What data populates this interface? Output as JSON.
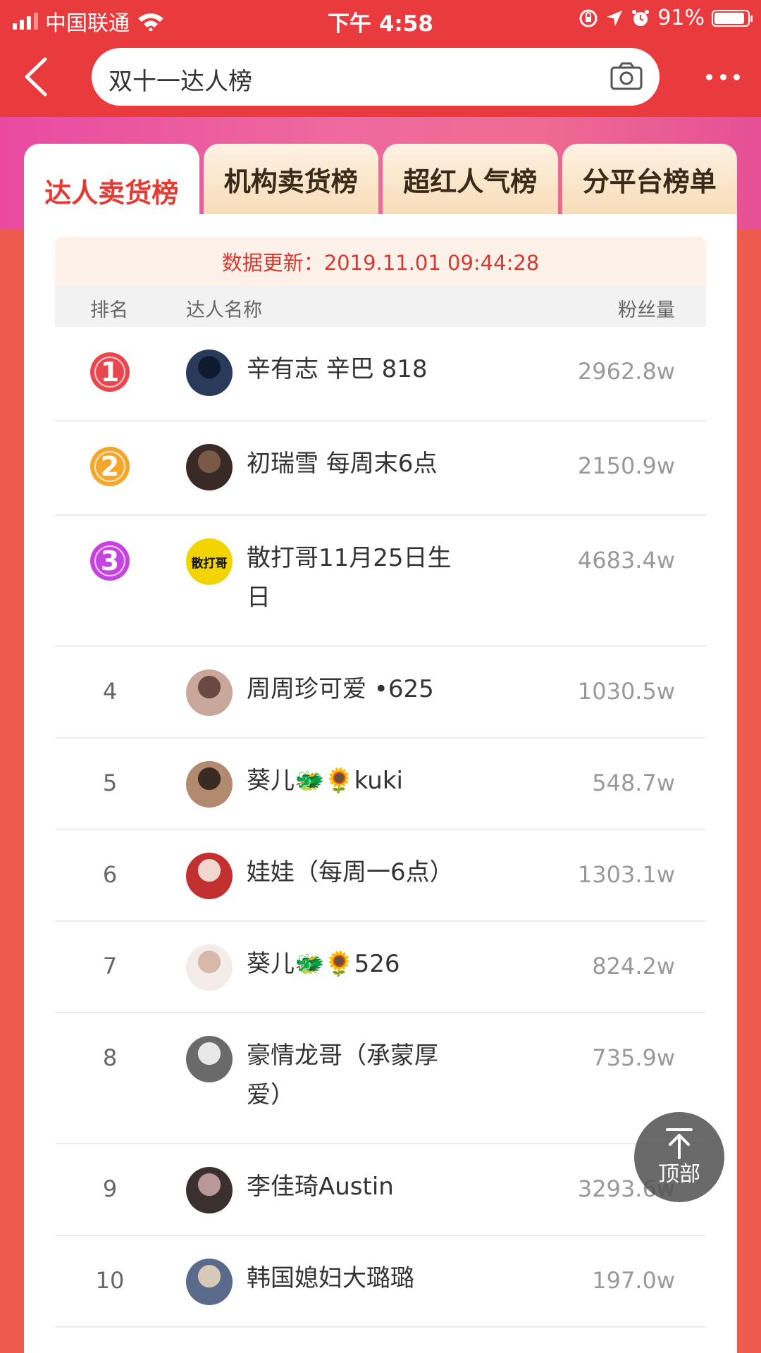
{
  "status_bar": {
    "carrier": "中国联通",
    "time": "下午 4:58",
    "battery": "91%",
    "battery_level": 0.91
  },
  "header": {
    "search_text": "双十一达人榜"
  },
  "tabs": [
    {
      "label": "达人卖货榜",
      "active": true
    },
    {
      "label": "机构卖货榜",
      "active": false
    },
    {
      "label": "超红人气榜",
      "active": false
    },
    {
      "label": "分平台榜单",
      "active": false
    }
  ],
  "update_text": "数据更新：2019.11.01 09:44:28",
  "table": {
    "headers": {
      "rank": "排名",
      "name": "达人名称",
      "fans": "粉丝量"
    },
    "rows": [
      {
        "rank": "1",
        "name": "辛有志 辛巴 818",
        "fans": "2962.8w"
      },
      {
        "rank": "2",
        "name": "初瑞雪 每周末6点",
        "fans": "2150.9w"
      },
      {
        "rank": "3",
        "name": "散打哥11月25日生日",
        "fans": "4683.4w",
        "avatar_text": "散打哥"
      },
      {
        "rank": "4",
        "name": "周周珍可爱 •625",
        "fans": "1030.5w"
      },
      {
        "rank": "5",
        "name": "葵儿🐲🌻kuki",
        "fans": "548.7w"
      },
      {
        "rank": "6",
        "name": "娃娃（每周一6点）",
        "fans": "1303.1w"
      },
      {
        "rank": "7",
        "name": "葵儿🐲🌻526",
        "fans": "824.2w"
      },
      {
        "rank": "8",
        "name": "豪情龙哥（承蒙厚爱）",
        "fans": "735.9w"
      },
      {
        "rank": "9",
        "name": "李佳琦Austin",
        "fans": "3293.6w"
      },
      {
        "rank": "10",
        "name": "韩国媳妇大璐璐",
        "fans": "197.0w"
      }
    ]
  },
  "scroll_top_button": "顶部",
  "colors": {
    "header_red": "#e93a3e",
    "rank1": "#e9474d",
    "rank2": "#f4a72c",
    "rank3": "#c743e0",
    "accent": "#e43b35"
  }
}
